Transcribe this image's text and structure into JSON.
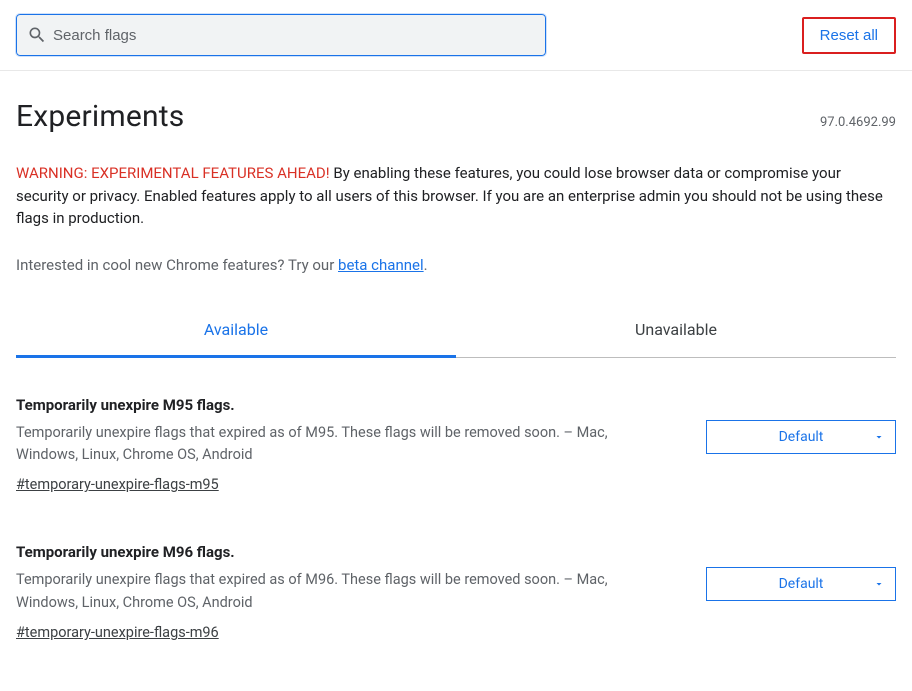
{
  "search": {
    "placeholder": "Search flags"
  },
  "reset": {
    "label": "Reset all"
  },
  "header": {
    "title": "Experiments",
    "version": "97.0.4692.99"
  },
  "warning": {
    "lead": "WARNING: EXPERIMENTAL FEATURES AHEAD!",
    "body": " By enabling these features, you could lose browser data or compromise your security or privacy. Enabled features apply to all users of this browser. If you are an enterprise admin you should not be using these flags in production."
  },
  "interest": {
    "prefix": "Interested in cool new Chrome features? Try our ",
    "link": "beta channel",
    "suffix": "."
  },
  "tabs": {
    "available": "Available",
    "unavailable": "Unavailable"
  },
  "flags": [
    {
      "title": "Temporarily unexpire M95 flags.",
      "desc": "Temporarily unexpire flags that expired as of M95. These flags will be removed soon. – Mac, Windows, Linux, Chrome OS, Android",
      "anchor": "#temporary-unexpire-flags-m95",
      "state": "Default"
    },
    {
      "title": "Temporarily unexpire M96 flags.",
      "desc": "Temporarily unexpire flags that expired as of M96. These flags will be removed soon. – Mac, Windows, Linux, Chrome OS, Android",
      "anchor": "#temporary-unexpire-flags-m96",
      "state": "Default"
    }
  ]
}
